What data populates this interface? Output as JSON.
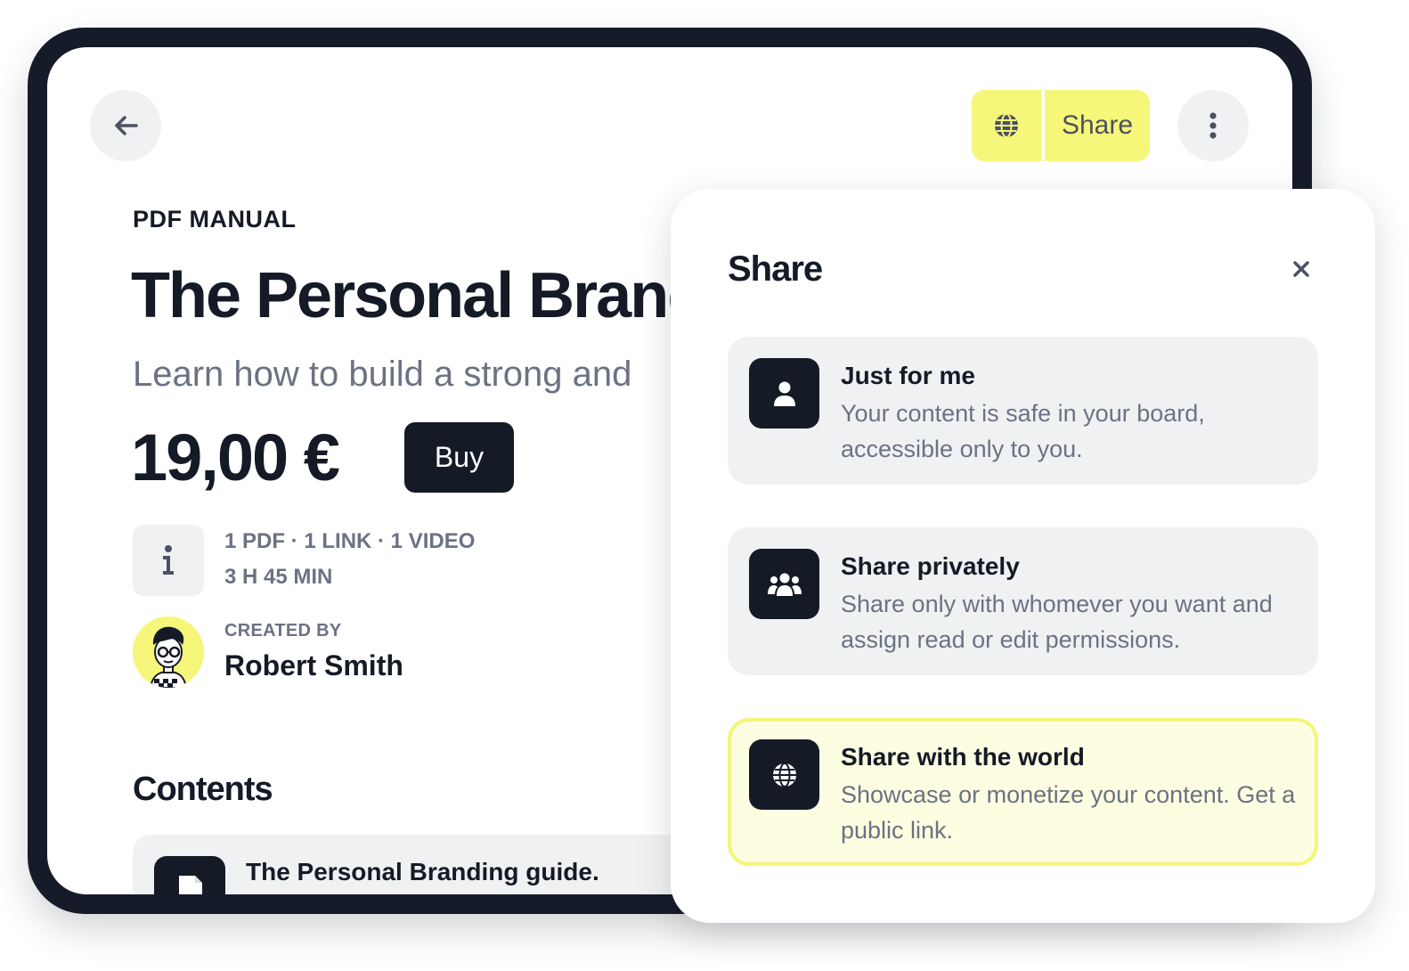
{
  "header": {
    "back_icon": "arrow-left-icon",
    "globe_icon": "globe-icon",
    "share_label": "Share",
    "more_icon": "more-vertical-icon"
  },
  "product": {
    "kicker": "PDF MANUAL",
    "title": "The Personal Branding",
    "subtitle": "Learn how to build a strong and",
    "price": "19,00 €",
    "buy_label": "Buy",
    "info_icon": "info-icon",
    "meta_line1": "1 PDF · 1 LINK · 1 VIDEO",
    "meta_line2": "3 H 45 MIN",
    "created_label": "CREATED BY",
    "creator_name": "Robert Smith"
  },
  "contents": {
    "heading": "Contents",
    "items": [
      {
        "label": "The Personal Branding guide.",
        "icon": "file-icon"
      }
    ]
  },
  "share_panel": {
    "title": "Share",
    "close_icon": "close-icon",
    "options": [
      {
        "title": "Just for me",
        "description": "Your content is safe in your board, accessible only to you.",
        "icon": "user-icon",
        "selected": false
      },
      {
        "title": "Share privately",
        "description": "Share only with whomever you want and assign read or edit permissions.",
        "icon": "users-icon",
        "selected": false
      },
      {
        "title": "Share with the world",
        "description": "Showcase or monetize your content. Get a public link.",
        "icon": "globe-icon",
        "selected": true
      }
    ]
  },
  "colors": {
    "accent": "#f6f77a",
    "dark": "#141a26",
    "muted": "#6b7282",
    "surface": "#f0f1f3"
  }
}
